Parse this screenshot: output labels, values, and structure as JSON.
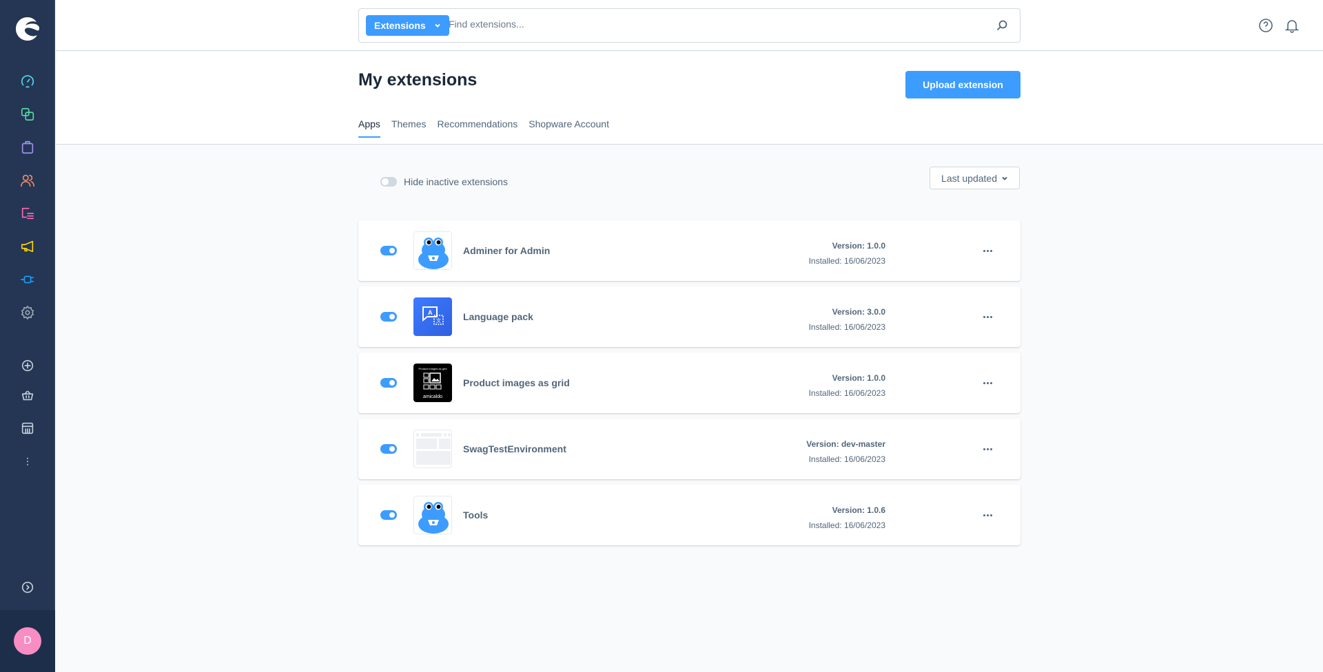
{
  "sidebar": {
    "items": [
      {
        "name": "dashboard",
        "icon": "gauge-icon",
        "color": "#57d9f2"
      },
      {
        "name": "catalogues",
        "icon": "products-icon",
        "color": "#57d9a3"
      },
      {
        "name": "orders",
        "icon": "shopping-bag-icon",
        "color": "#a092f0"
      },
      {
        "name": "customers",
        "icon": "users-icon",
        "color": "#f88962"
      },
      {
        "name": "content",
        "icon": "content-icon",
        "color": "#ff68b4"
      },
      {
        "name": "marketing",
        "icon": "megaphone-icon",
        "color": "#ffd700"
      },
      {
        "name": "extensions",
        "icon": "plug-icon",
        "color": "#189eff"
      },
      {
        "name": "settings",
        "icon": "gear-icon",
        "color": "#9aa8b5"
      }
    ],
    "secondary": [
      {
        "name": "add-sales-channel",
        "icon": "plus-circle-icon"
      },
      {
        "name": "storefront",
        "icon": "basket-icon"
      },
      {
        "name": "headless",
        "icon": "store-icon"
      },
      {
        "name": "more",
        "icon": "more-vertical-icon"
      }
    ],
    "collapse_icon": "chevron-right-circle-icon",
    "user_initial": "D"
  },
  "search": {
    "type_label": "Extensions",
    "placeholder": "Find extensions..."
  },
  "header": {
    "title": "My extensions",
    "upload_label": "Upload extension",
    "tabs": [
      {
        "label": "Apps",
        "active": true
      },
      {
        "label": "Themes",
        "active": false
      },
      {
        "label": "Recommendations",
        "active": false
      },
      {
        "label": "Shopware Account",
        "active": false
      }
    ]
  },
  "filter": {
    "hide_inactive_label": "Hide inactive extensions",
    "hide_inactive_on": false,
    "sort_label": "Last updated"
  },
  "extensions": [
    {
      "name": "Adminer for Admin",
      "version": "Version: 1.0.0",
      "installed": "Installed: 16/06/2023",
      "active": true,
      "icon": "frog"
    },
    {
      "name": "Language pack",
      "version": "Version: 3.0.0",
      "installed": "Installed: 16/06/2023",
      "active": true,
      "icon": "language"
    },
    {
      "name": "Product images as grid",
      "version": "Version: 1.0.0",
      "installed": "Installed: 16/06/2023",
      "active": true,
      "icon": "grid",
      "icon_caption": "Product images as grid",
      "icon_brand": "amicaldo"
    },
    {
      "name": "SwagTestEnvironment",
      "version": "Version: dev-master",
      "installed": "Installed: 16/06/2023",
      "active": true,
      "icon": "placeholder"
    },
    {
      "name": "Tools",
      "version": "Version: 1.0.6",
      "installed": "Installed: 16/06/2023",
      "active": true,
      "icon": "frog"
    }
  ],
  "colors": {
    "accent": "#3d9cff",
    "sidebar_bg": "#243653"
  }
}
